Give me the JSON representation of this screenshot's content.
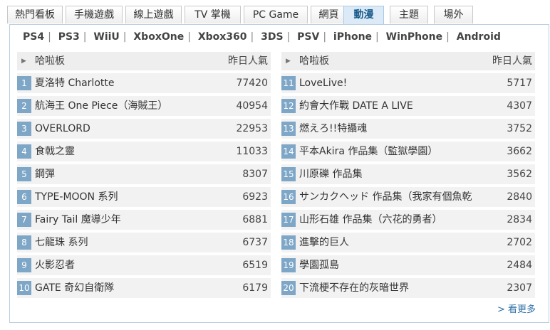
{
  "tabs": [
    {
      "label": "熱門看板"
    },
    {
      "label": "手機遊戲"
    },
    {
      "label": "線上遊戲"
    },
    {
      "label": "TV 掌機"
    },
    {
      "label": "PC Game"
    },
    {
      "label": "網頁"
    },
    {
      "label": "動漫",
      "active": true
    },
    {
      "label": "主題"
    },
    {
      "label": "場外"
    }
  ],
  "platforms": [
    "PS4",
    "PS3",
    "WiiU",
    "XboxOne",
    "Xbox360",
    "3DS",
    "PSV",
    "iPhone",
    "WinPhone",
    "Android"
  ],
  "platform_separator": "|",
  "columns": [
    {
      "header_name": "哈啦板",
      "header_pop": "昨日人氣",
      "rows": [
        {
          "rank": "1",
          "title": "夏洛特 Charlotte",
          "count": "77420"
        },
        {
          "rank": "2",
          "title": "航海王 One Piece（海賊王）",
          "count": "40954"
        },
        {
          "rank": "3",
          "title": "OVERLORD",
          "count": "22953"
        },
        {
          "rank": "4",
          "title": "食戟之靈",
          "count": "11033"
        },
        {
          "rank": "5",
          "title": "鋼彈",
          "count": "8307"
        },
        {
          "rank": "6",
          "title": "TYPE-MOON 系列",
          "count": "6923"
        },
        {
          "rank": "7",
          "title": "Fairy Tail 魔導少年",
          "count": "6881"
        },
        {
          "rank": "8",
          "title": "七龍珠 系列",
          "count": "6737"
        },
        {
          "rank": "9",
          "title": "火影忍者",
          "count": "6519"
        },
        {
          "rank": "10",
          "title": "GATE 奇幻自衛隊",
          "count": "6179"
        }
      ]
    },
    {
      "header_name": "哈啦板",
      "header_pop": "昨日人氣",
      "rows": [
        {
          "rank": "11",
          "title": "LoveLive!",
          "count": "5717"
        },
        {
          "rank": "12",
          "title": "約會大作戰 DATE A LIVE",
          "count": "4307"
        },
        {
          "rank": "13",
          "title": "燃えろ!!特攝魂",
          "count": "3752"
        },
        {
          "rank": "14",
          "title": "平本Akira 作品集（監獄學園）",
          "count": "3662"
        },
        {
          "rank": "15",
          "title": "川原礫 作品集",
          "count": "3562"
        },
        {
          "rank": "16",
          "title": "サンカクヘッド 作品集（我家有個魚乾",
          "count": "2840"
        },
        {
          "rank": "17",
          "title": "山形石雄 作品集（六花的勇者）",
          "count": "2834"
        },
        {
          "rank": "18",
          "title": "進擊的巨人",
          "count": "2702"
        },
        {
          "rank": "19",
          "title": "學園孤島",
          "count": "2484"
        },
        {
          "rank": "20",
          "title": "下流梗不存在的灰暗世界",
          "count": "2307"
        }
      ]
    }
  ],
  "more_link": "> 看更多",
  "colors": {
    "accent": "#7ea6c7",
    "active_tab_bg": "#dbeaf6",
    "link": "#2d6fa6"
  }
}
